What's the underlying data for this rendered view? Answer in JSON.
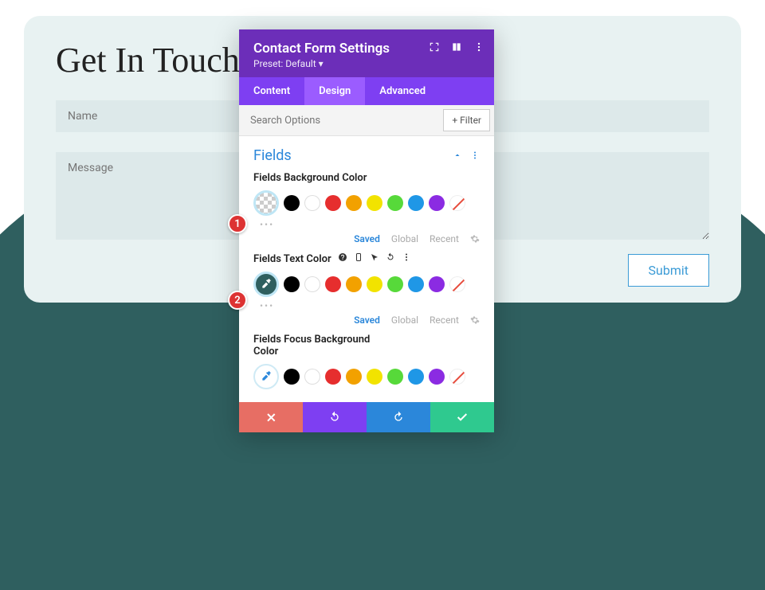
{
  "page": {
    "heading": "Get In Touch",
    "name_ph": "Name",
    "msg_ph": "Message",
    "submit": "Submit"
  },
  "panel": {
    "title": "Contact Form Settings",
    "preset": "Preset: Default ▾",
    "tabs": {
      "content": "Content",
      "design": "Design",
      "advanced": "Advanced"
    },
    "search_ph": "Search Options",
    "filter": "+ Filter",
    "section": "Fields",
    "opt1": "Fields Background Color",
    "opt2": "Fields Text Color",
    "opt3": "Fields Focus Background Color",
    "status": {
      "saved": "Saved",
      "global": "Global",
      "recent": "Recent"
    }
  },
  "swatches": [
    "#000000",
    "#ffffff",
    "#e62e2e",
    "#f2a100",
    "#f2e300",
    "#57d93a",
    "#1f97e6",
    "#8b2be2"
  ],
  "badges": {
    "b1": "1",
    "b2": "2"
  }
}
